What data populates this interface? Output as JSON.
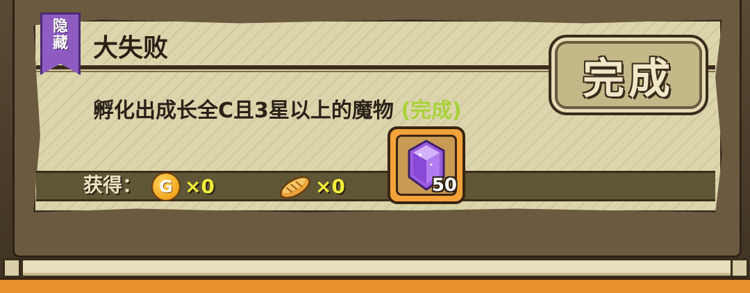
{
  "tag": {
    "line1": "隐",
    "line2": "藏"
  },
  "title": "大失败",
  "description": "孵化出成长全C且3星以上的魔物",
  "status": "(完成)",
  "complete_button": "完成",
  "rewards": {
    "label": "获得：",
    "coin": {
      "icon": "gold-coin-icon",
      "glyph": "G",
      "count": "×0"
    },
    "bread": {
      "icon": "bread-icon",
      "count": "×0"
    },
    "gem": {
      "icon": "purple-gem-icon",
      "amount": "50"
    }
  },
  "colors": {
    "tag": "#8e5cc0",
    "status": "#a9d23a",
    "count": "#f3ee3a",
    "gem_frame": "#f3a33a"
  }
}
